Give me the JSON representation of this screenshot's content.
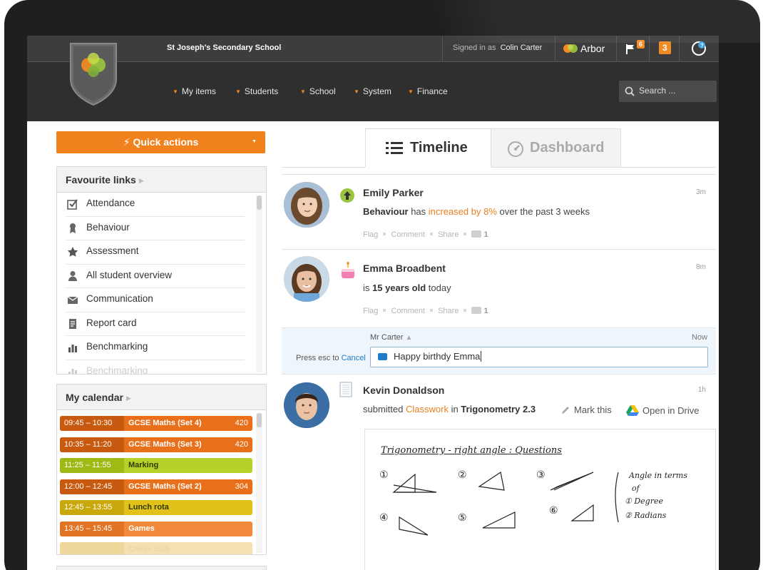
{
  "header": {
    "school_name": "St Joseph's Secondary School",
    "signed_in_prefix": "Signed in as",
    "signed_in_user": "Colin Carter",
    "brand": "Arbor",
    "flag_count": "6",
    "notification_count": "3",
    "search_placeholder": "Search ...",
    "nav": [
      "My items",
      "Students",
      "School",
      "System",
      "Finance"
    ]
  },
  "sidebar": {
    "quick_actions": "Quick actions",
    "favourites": {
      "title": "Favourite links",
      "items": [
        "Attendance",
        "Behaviour",
        "Assessment",
        "All student overview",
        "Communication",
        "Report card",
        "Benchmarking",
        "Benchmarking"
      ]
    },
    "calendar": {
      "title": "My calendar",
      "events": [
        {
          "time": "09:45 – 10:30",
          "name": "GCSE Maths (Set 4)",
          "count": "420",
          "color": "#e8701a",
          "time_color": "#c85a10"
        },
        {
          "time": "10:35 – 11:20",
          "name": "GCSE Maths (Set 3)",
          "count": "420",
          "color": "#e8701a",
          "time_color": "#c85a10"
        },
        {
          "time": "11:25 – 11:55",
          "name": "Marking",
          "count": "",
          "color": "#b7d12a",
          "time_color": "#9dbb14"
        },
        {
          "time": "12:00 – 12:45",
          "name": "GCSE Maths (Set 2)",
          "count": "304",
          "color": "#e8701a",
          "time_color": "#c85a10"
        },
        {
          "time": "12:45 – 13:55",
          "name": "Lunch rota",
          "count": "",
          "color": "#e2c21a",
          "time_color": "#c9a80e"
        },
        {
          "time": "13:45 – 15:45",
          "name": "Games",
          "count": "",
          "color": "#f2893a",
          "time_color": "#e07324"
        },
        {
          "time": "15:00 – 16:00",
          "name": "Chess club",
          "count": "",
          "color": "#f3e2b0",
          "time_color": "#f0d89a"
        }
      ]
    }
  },
  "tabs": {
    "timeline": "Timeline",
    "dashboard": "Dashboard"
  },
  "feed": {
    "items": [
      {
        "name": "Emily Parker",
        "time": "3m",
        "desc_bold": "Behaviour",
        "desc_mid": " has ",
        "desc_hl": "increased by 8%",
        "desc_end": " over the past 3 weeks",
        "comments": "1"
      },
      {
        "name": "Emma Broadbent",
        "time": "8m",
        "desc_pre": "is ",
        "desc_bold": "15 years old",
        "desc_end": " today",
        "comments": "1"
      },
      {
        "name": "Kevin Donaldson",
        "time": "1h",
        "desc_pre": "submitted ",
        "desc_hl": "Classwork",
        "desc_mid": " in ",
        "desc_bold": "Trigonometry 2.3",
        "mark": "Mark this",
        "drive": "Open in Drive"
      }
    ],
    "action_flag": "Flag",
    "action_comment": "Comment",
    "action_share": "Share"
  },
  "reply": {
    "author": "Mr Carter",
    "time": "Now",
    "press": "Press esc to",
    "cancel": "Cancel",
    "text": "Happy birthdy Emma"
  },
  "worksheet": {
    "title": "Trigonometry - right angle : Questions",
    "notes": [
      "Angle in terms",
      "of",
      "① Degree",
      "② Radians"
    ]
  }
}
